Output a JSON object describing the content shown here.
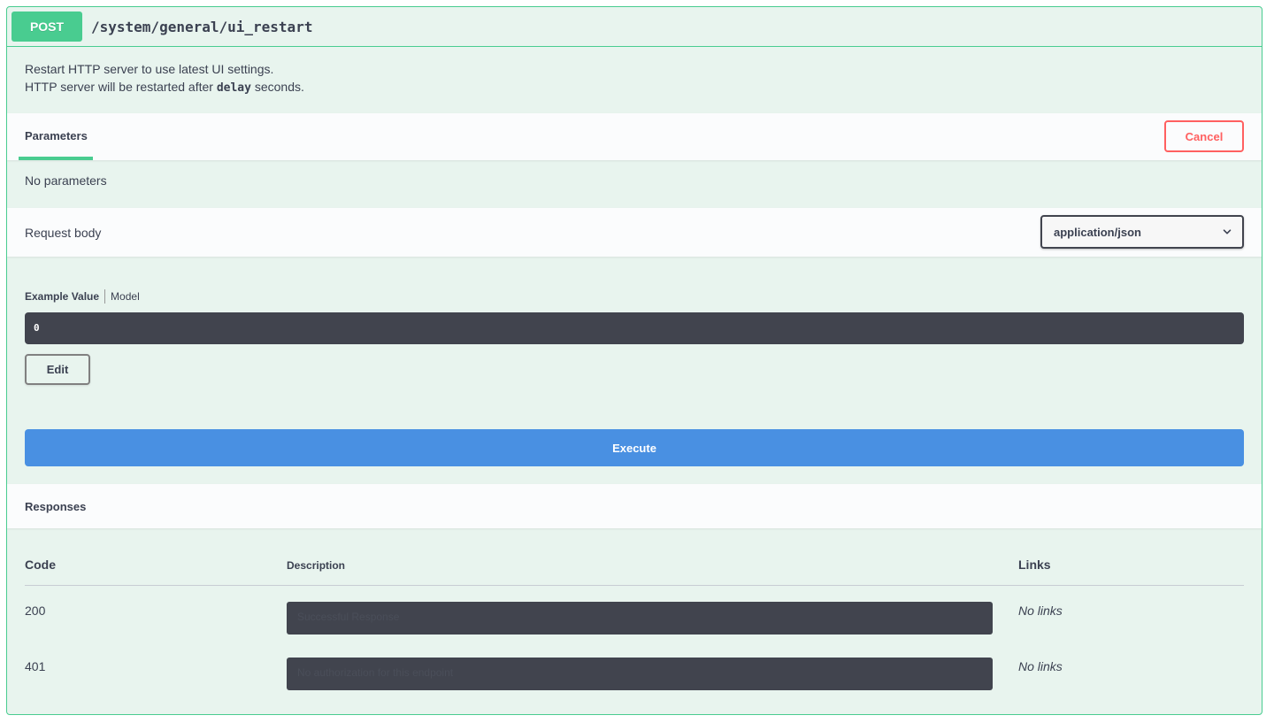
{
  "operation": {
    "method": "POST",
    "path": "/system/general/ui_restart",
    "description_line1": "Restart HTTP server to use latest UI settings.",
    "description_line2_pre": "HTTP server will be restarted after ",
    "description_line2_code": "delay",
    "description_line2_post": " seconds."
  },
  "parameters": {
    "tab_label": "Parameters",
    "cancel_label": "Cancel",
    "empty_text": "No parameters"
  },
  "request_body": {
    "label": "Request body",
    "content_type": "application/json",
    "tabs": {
      "example": "Example Value",
      "model": "Model"
    },
    "example_value": "0",
    "edit_label": "Edit"
  },
  "execute_label": "Execute",
  "responses": {
    "title": "Responses",
    "columns": {
      "code": "Code",
      "description": "Description",
      "links": "Links"
    },
    "rows": [
      {
        "code": "200",
        "description": "Successful Response",
        "links": "No links"
      },
      {
        "code": "401",
        "description": "No authorization for this endpoint",
        "links": "No links"
      }
    ]
  }
}
